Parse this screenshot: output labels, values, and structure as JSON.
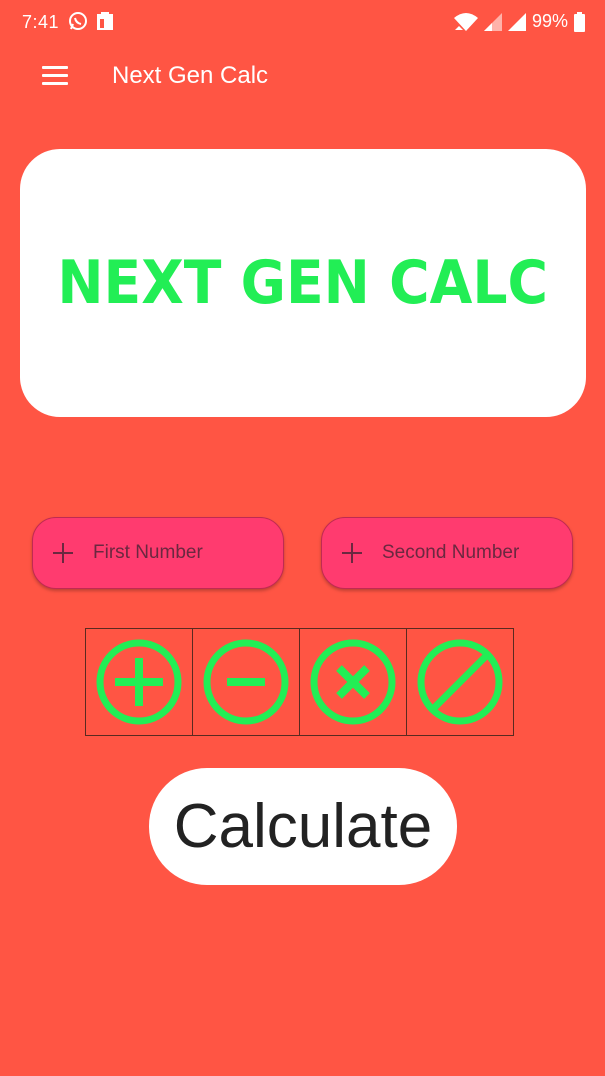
{
  "status_bar": {
    "time": "7:41",
    "battery": "99%",
    "icons": [
      "whatsapp-icon",
      "clipboard-icon",
      "wifi-icon",
      "signal-icon",
      "signal-icon",
      "battery-icon"
    ]
  },
  "app_bar": {
    "title": "Next Gen Calc",
    "menu_icon": "hamburger-menu-icon"
  },
  "banner": {
    "text": "NEXT GEN CALC"
  },
  "inputs": {
    "first_placeholder": "First Number",
    "first_value": "",
    "second_placeholder": "Second Number",
    "second_value": ""
  },
  "operations": [
    {
      "name": "add",
      "icon": "plus-circle-icon"
    },
    {
      "name": "subtract",
      "icon": "minus-circle-icon"
    },
    {
      "name": "multiply",
      "icon": "times-circle-icon"
    },
    {
      "name": "divide",
      "icon": "slash-circle-icon"
    }
  ],
  "calculate_label": "Calculate",
  "colors": {
    "background": "#ff5544",
    "accent_green": "#22ee55",
    "input_fill": "#ff3b6f",
    "input_text": "#6b2840",
    "button_text": "#222222"
  }
}
